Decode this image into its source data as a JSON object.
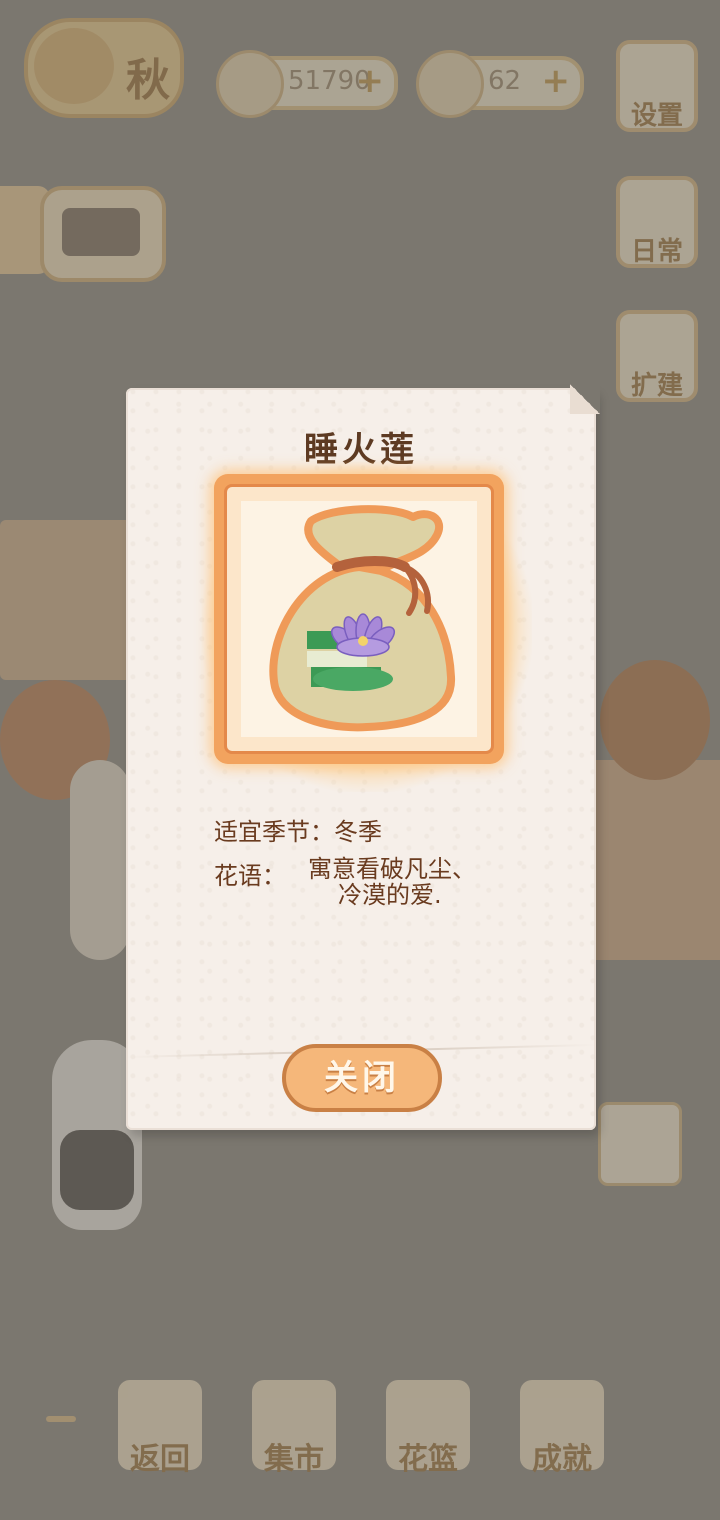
{
  "background": {
    "season_label": "秋",
    "currencies": [
      {
        "icon": "fish-bone-icon",
        "value": "51790"
      },
      {
        "icon": "cheese-icon",
        "value": "62"
      }
    ],
    "side_buttons": [
      {
        "icon": "gear-icon",
        "label": "设置"
      },
      {
        "icon": "calendar-icon",
        "label": "日常"
      },
      {
        "icon": "hammer-icon",
        "label": "扩建"
      }
    ],
    "bottom_nav": [
      {
        "icon": "back-icon",
        "label": "返回"
      },
      {
        "icon": "market-icon",
        "label": "集市"
      },
      {
        "icon": "flower-basket-icon",
        "label": "花篮"
      },
      {
        "icon": "trophy-icon",
        "label": "成就"
      }
    ]
  },
  "modal": {
    "title": "睡火莲",
    "season_text": "适宜季节：冬季",
    "language_label": "花语：",
    "language_line1": "寓意看破凡尘、",
    "language_line2": "冷漠的爱.",
    "close_label": "关闭"
  }
}
